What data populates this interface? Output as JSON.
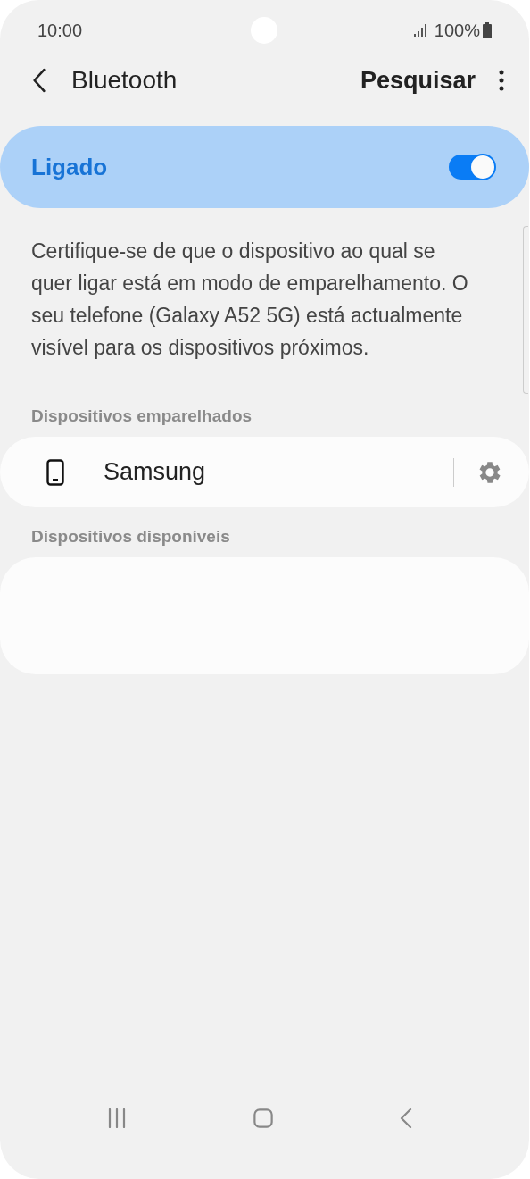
{
  "status_bar": {
    "time": "10:00",
    "battery": "100%"
  },
  "header": {
    "title": "Bluetooth",
    "action": "Pesquisar"
  },
  "master_switch": {
    "label": "Ligado",
    "on": true
  },
  "description": "Certifique-se de que o dispositivo ao qual se quer ligar está em modo de emparelhamento. O seu telefone (Galaxy A52 5G) está actualmente visível para os dispositivos próximos.",
  "sections": [
    {
      "title": "Dispositivos emparelhados",
      "devices": [
        {
          "name": "Samsung",
          "kind": "phone"
        }
      ]
    },
    {
      "title": "Dispositivos disponíveis"
    }
  ]
}
